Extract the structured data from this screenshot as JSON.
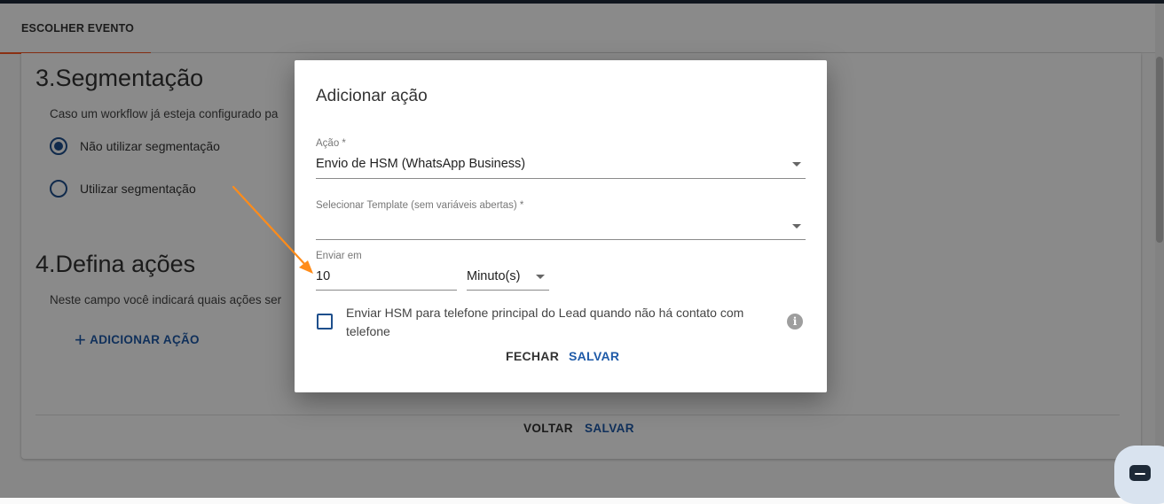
{
  "tabs": {
    "active_label": "ESCOLHER EVENTO"
  },
  "page": {
    "segmentation": {
      "title": "3.Segmentação",
      "description": "Caso um workflow já esteja configurado pa",
      "options": [
        {
          "label": "Não utilizar segmentação",
          "selected": true
        },
        {
          "label": "Utilizar segmentação",
          "selected": false
        }
      ]
    },
    "actions": {
      "title": "4.Defina ações",
      "description": "Neste campo você indicará quais ações ser",
      "add_label": "ADICIONAR AÇÃO"
    },
    "footer": {
      "back_label": "VOLTAR",
      "save_label": "SALVAR"
    }
  },
  "dialog": {
    "title": "Adicionar ação",
    "action_field": {
      "label": "Ação *",
      "value": "Envio de HSM (WhatsApp Business)"
    },
    "template_field": {
      "label": "Selecionar Template (sem variáveis abertas) *",
      "value": ""
    },
    "send_in": {
      "label": "Enviar em",
      "value": "10",
      "unit": "Minuto(s)"
    },
    "checkbox": {
      "label": "Enviar HSM para telefone principal do Lead quando não há contato com telefone",
      "checked": false
    },
    "info_icon": "i",
    "buttons": {
      "close_label": "FECHAR",
      "save_label": "SALVAR"
    }
  },
  "colors": {
    "primary": "#1e5aa8",
    "tab_accent": "#ff5722",
    "annotation_arrow": "#ff8c1a",
    "topbar": "#1e2a38"
  },
  "icons": {
    "radio": "radio-icon",
    "add": "plus-icon",
    "dropdown": "chevron-down-icon",
    "info": "info-icon",
    "chat": "chat-icon"
  }
}
